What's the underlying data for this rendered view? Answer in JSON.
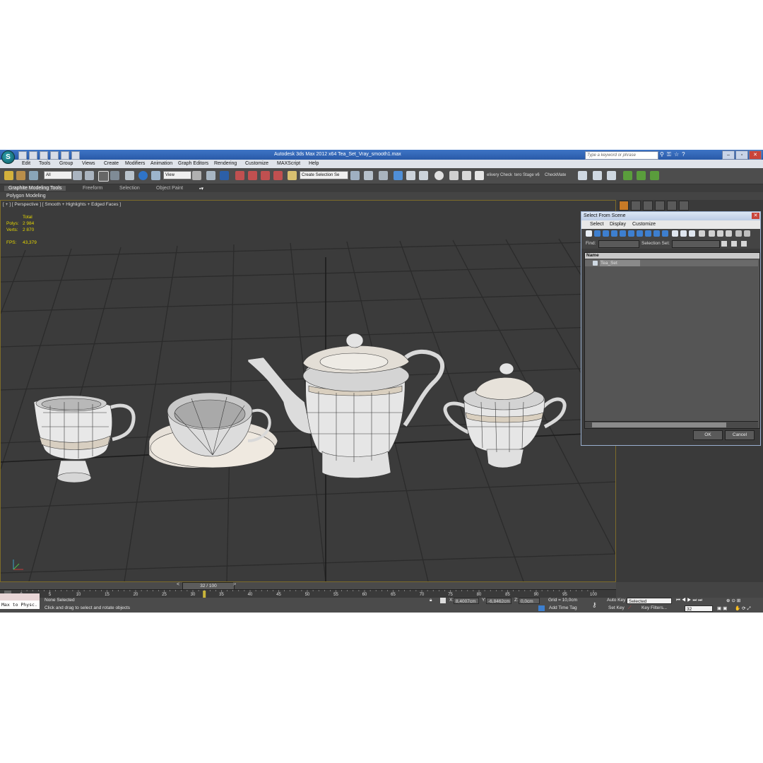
{
  "titlebar": {
    "title": "Autodesk 3ds Max  2012 x64     Tea_Set_Vray_smooth1.max",
    "search_placeholder": "Type a keyword or phrase",
    "logo": "S"
  },
  "menu": [
    "Edit",
    "Tools",
    "Group",
    "Views",
    "Create",
    "Modifiers",
    "Animation",
    "Graph Editors",
    "Rendering",
    "Customize",
    "MAXScript",
    "Help"
  ],
  "toolbar": {
    "filter_dropdown": "All",
    "refcoord_dropdown": "View",
    "selection_set": "Create Selection Se",
    "text_items": [
      "elivery Check",
      "tero Stage v6",
      "CheckMate"
    ]
  },
  "ribbon": {
    "tabs": [
      "Graphite Modeling Tools",
      "Freeform",
      "Selection",
      "Object Paint"
    ],
    "panel": "Polygon Modeling"
  },
  "viewport": {
    "label": "[ + ] [ Perspective ] [ Smooth + Highlights + Edged Faces ]",
    "stats": {
      "total": "Total",
      "polys_label": "Polys:",
      "polys": "2 984",
      "verts_label": "Verts:",
      "verts": "2 870",
      "fps_label": "FPS:",
      "fps": "43,379"
    }
  },
  "dialog": {
    "title": "Select From Scene",
    "menu": [
      "Select",
      "Display",
      "Customize"
    ],
    "find_label": "Find:",
    "selection_set_label": "Selection Set:",
    "column": "Name",
    "items": [
      "Tea_Set"
    ],
    "ok": "OK",
    "cancel": "Cancel"
  },
  "timeline": {
    "frame": "32 / 100",
    "ticks": [
      "0",
      "5",
      "10",
      "15",
      "20",
      "25",
      "30",
      "35",
      "40",
      "45",
      "50",
      "55",
      "60",
      "65",
      "70",
      "75",
      "80",
      "85",
      "90",
      "95",
      "100"
    ],
    "position": 32
  },
  "status": {
    "maxscript": "Max to Physc.",
    "selection": "None Selected",
    "prompt": "Click and drag to select and rotate objects",
    "x_label": "X:",
    "x": "8,4007cm",
    "y_label": "Y:",
    "y": "-6,8462cm",
    "z_label": "Z:",
    "z": "0,0cm",
    "grid": "Grid = 10,0cm",
    "add_time_tag": "Add Time Tag",
    "auto_key": "Auto Key",
    "set_key": "Set Key",
    "key_mode": "Selected",
    "key_filters": "Key Filters...",
    "current_frame": "32"
  }
}
